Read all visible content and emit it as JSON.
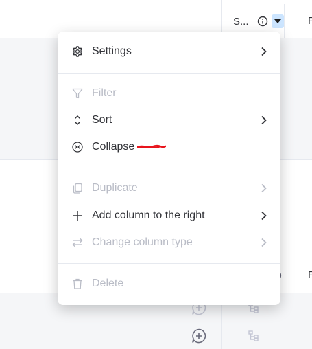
{
  "column_header": {
    "label": "S...",
    "info_icon": "info-icon",
    "dropdown_icon": "caret-down-icon",
    "dropdown_bg": "#cce5ff"
  },
  "next_column_header_partial": "F",
  "bottom_partial_text": "F",
  "menu": {
    "items": [
      {
        "label": "Settings",
        "icon": "gear-icon",
        "submenu": true,
        "disabled": false
      },
      {
        "label": "Filter",
        "icon": "filter-icon",
        "submenu": false,
        "disabled": true
      },
      {
        "label": "Sort",
        "icon": "sort-icon",
        "submenu": true,
        "disabled": false
      },
      {
        "label": "Collapse",
        "icon": "collapse-icon",
        "submenu": false,
        "disabled": false
      },
      {
        "label": "Duplicate",
        "icon": "duplicate-icon",
        "submenu": true,
        "disabled": true
      },
      {
        "label": "Add column to the right",
        "icon": "plus-icon",
        "submenu": true,
        "disabled": false
      },
      {
        "label": "Change column type",
        "icon": "swap-icon",
        "submenu": true,
        "disabled": true
      },
      {
        "label": "Delete",
        "icon": "trash-icon",
        "submenu": false,
        "disabled": true
      }
    ]
  },
  "colors": {
    "text": "#323338",
    "disabled_text": "#b9bcc6",
    "row_grey": "#f5f6f8",
    "border": "#e6e9ef",
    "redaction": "#e8141c"
  }
}
